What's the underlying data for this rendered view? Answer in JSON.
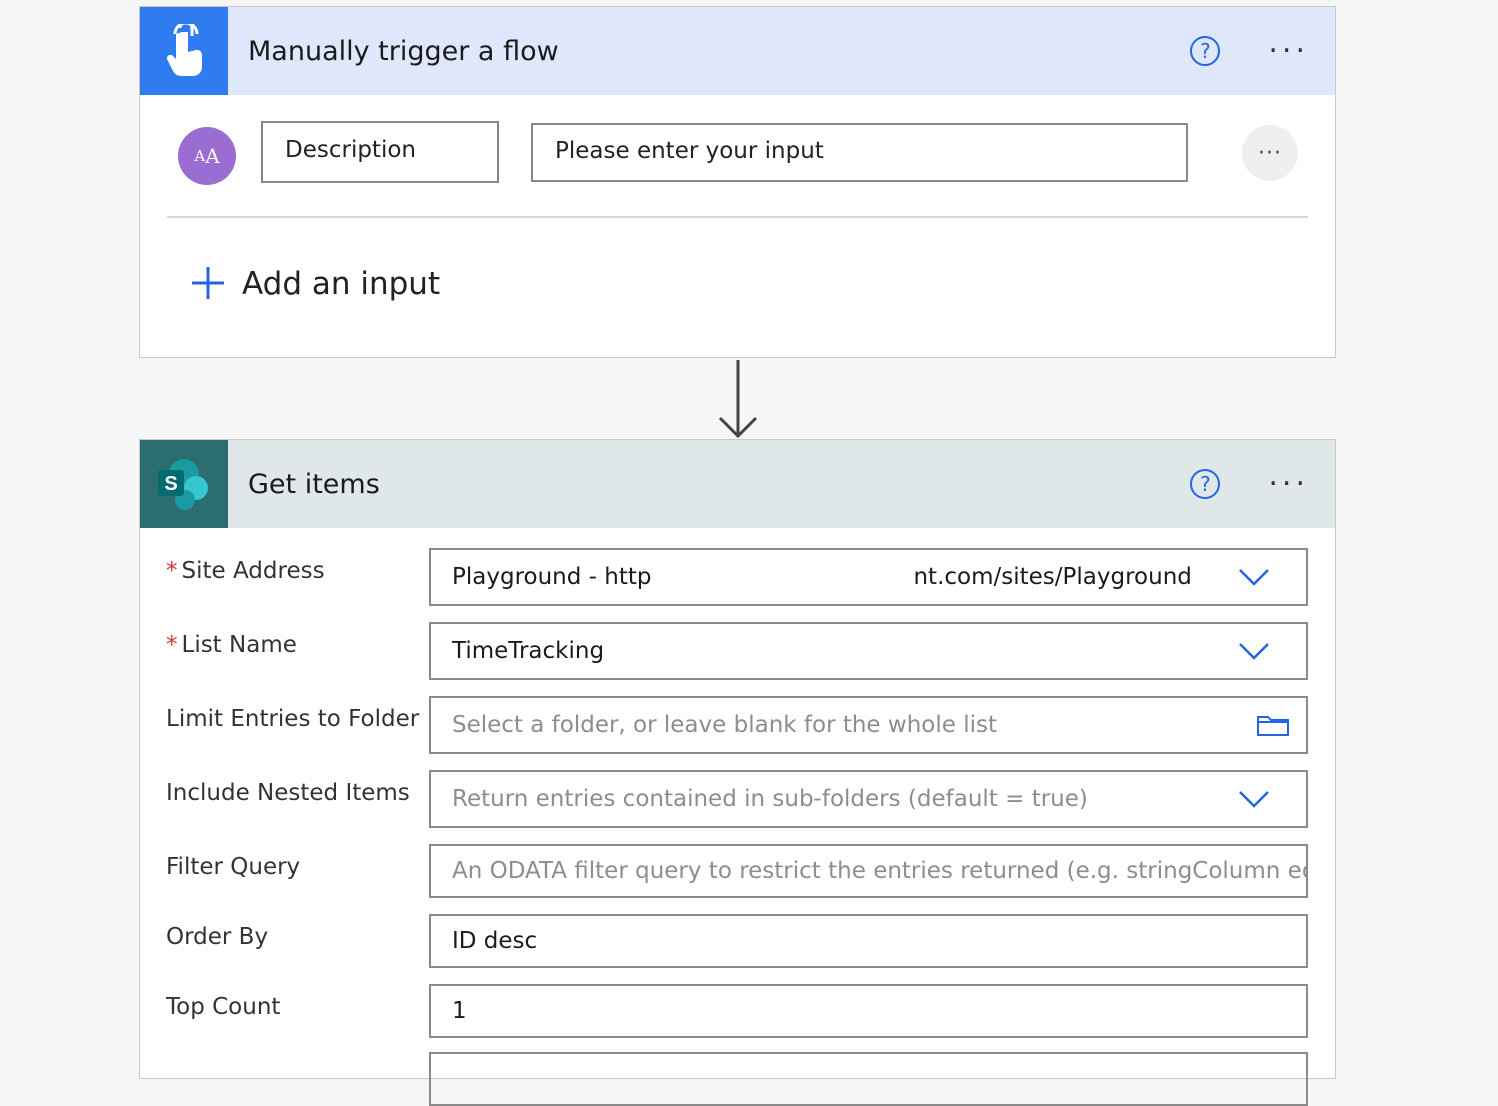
{
  "trigger": {
    "title": "Manually trigger a flow",
    "help_icon": "question-circle-icon",
    "more_icon": "ellipsis-icon",
    "input": {
      "avatar_text": "AA",
      "name_value": "Description",
      "value_placeholder": "Please enter your input",
      "more_label": "···"
    },
    "add_input_label": "Add an input"
  },
  "action": {
    "title": "Get items",
    "icon": "sharepoint-icon",
    "icon_letter": "S",
    "fields": [
      {
        "label": "Site Address",
        "required": true,
        "value": "Playground - http",
        "value_tail": "nt.com/sites/Playground",
        "kind": "dropdown"
      },
      {
        "label": "List Name",
        "required": true,
        "value": "TimeTracking",
        "kind": "dropdown"
      },
      {
        "label": "Limit Entries to Folder",
        "required": false,
        "placeholder": "Select a folder, or leave blank for the whole list",
        "kind": "folder"
      },
      {
        "label": "Include Nested Items",
        "required": false,
        "placeholder": "Return entries contained in sub-folders (default = true)",
        "kind": "dropdown"
      },
      {
        "label": "Filter Query",
        "required": false,
        "placeholder": "An ODATA filter query to restrict the entries returned (e.g. stringColumn eq 'str",
        "kind": "text"
      },
      {
        "label": "Order By",
        "required": false,
        "value": "ID desc",
        "kind": "text"
      },
      {
        "label": "Top Count",
        "required": false,
        "value": "1",
        "kind": "text"
      }
    ]
  },
  "colors": {
    "accent": "#2266e3",
    "trigger_header": "#dfe8fb",
    "trigger_icon_bg": "#2f7cf0",
    "action_header": "#dfe7e8",
    "action_icon_bg": "#2c6e70",
    "required": "#d13438"
  }
}
